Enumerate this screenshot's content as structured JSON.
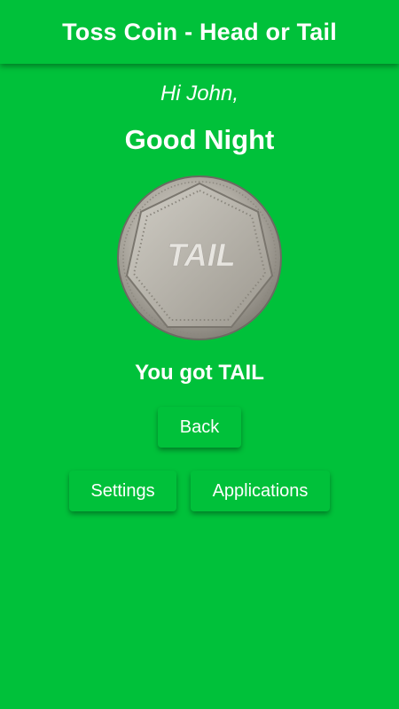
{
  "app_title": "Toss Coin - Head or Tail",
  "greeting": "Hi John,",
  "time_of_day": "Good Night",
  "coin": {
    "face_text": "TAIL",
    "icon": "coin-tail-icon"
  },
  "result_text": "You got TAIL",
  "buttons": {
    "back": "Back",
    "settings": "Settings",
    "applications": "Applications"
  },
  "colors": {
    "background": "#00c13a",
    "text": "#ffffff"
  }
}
